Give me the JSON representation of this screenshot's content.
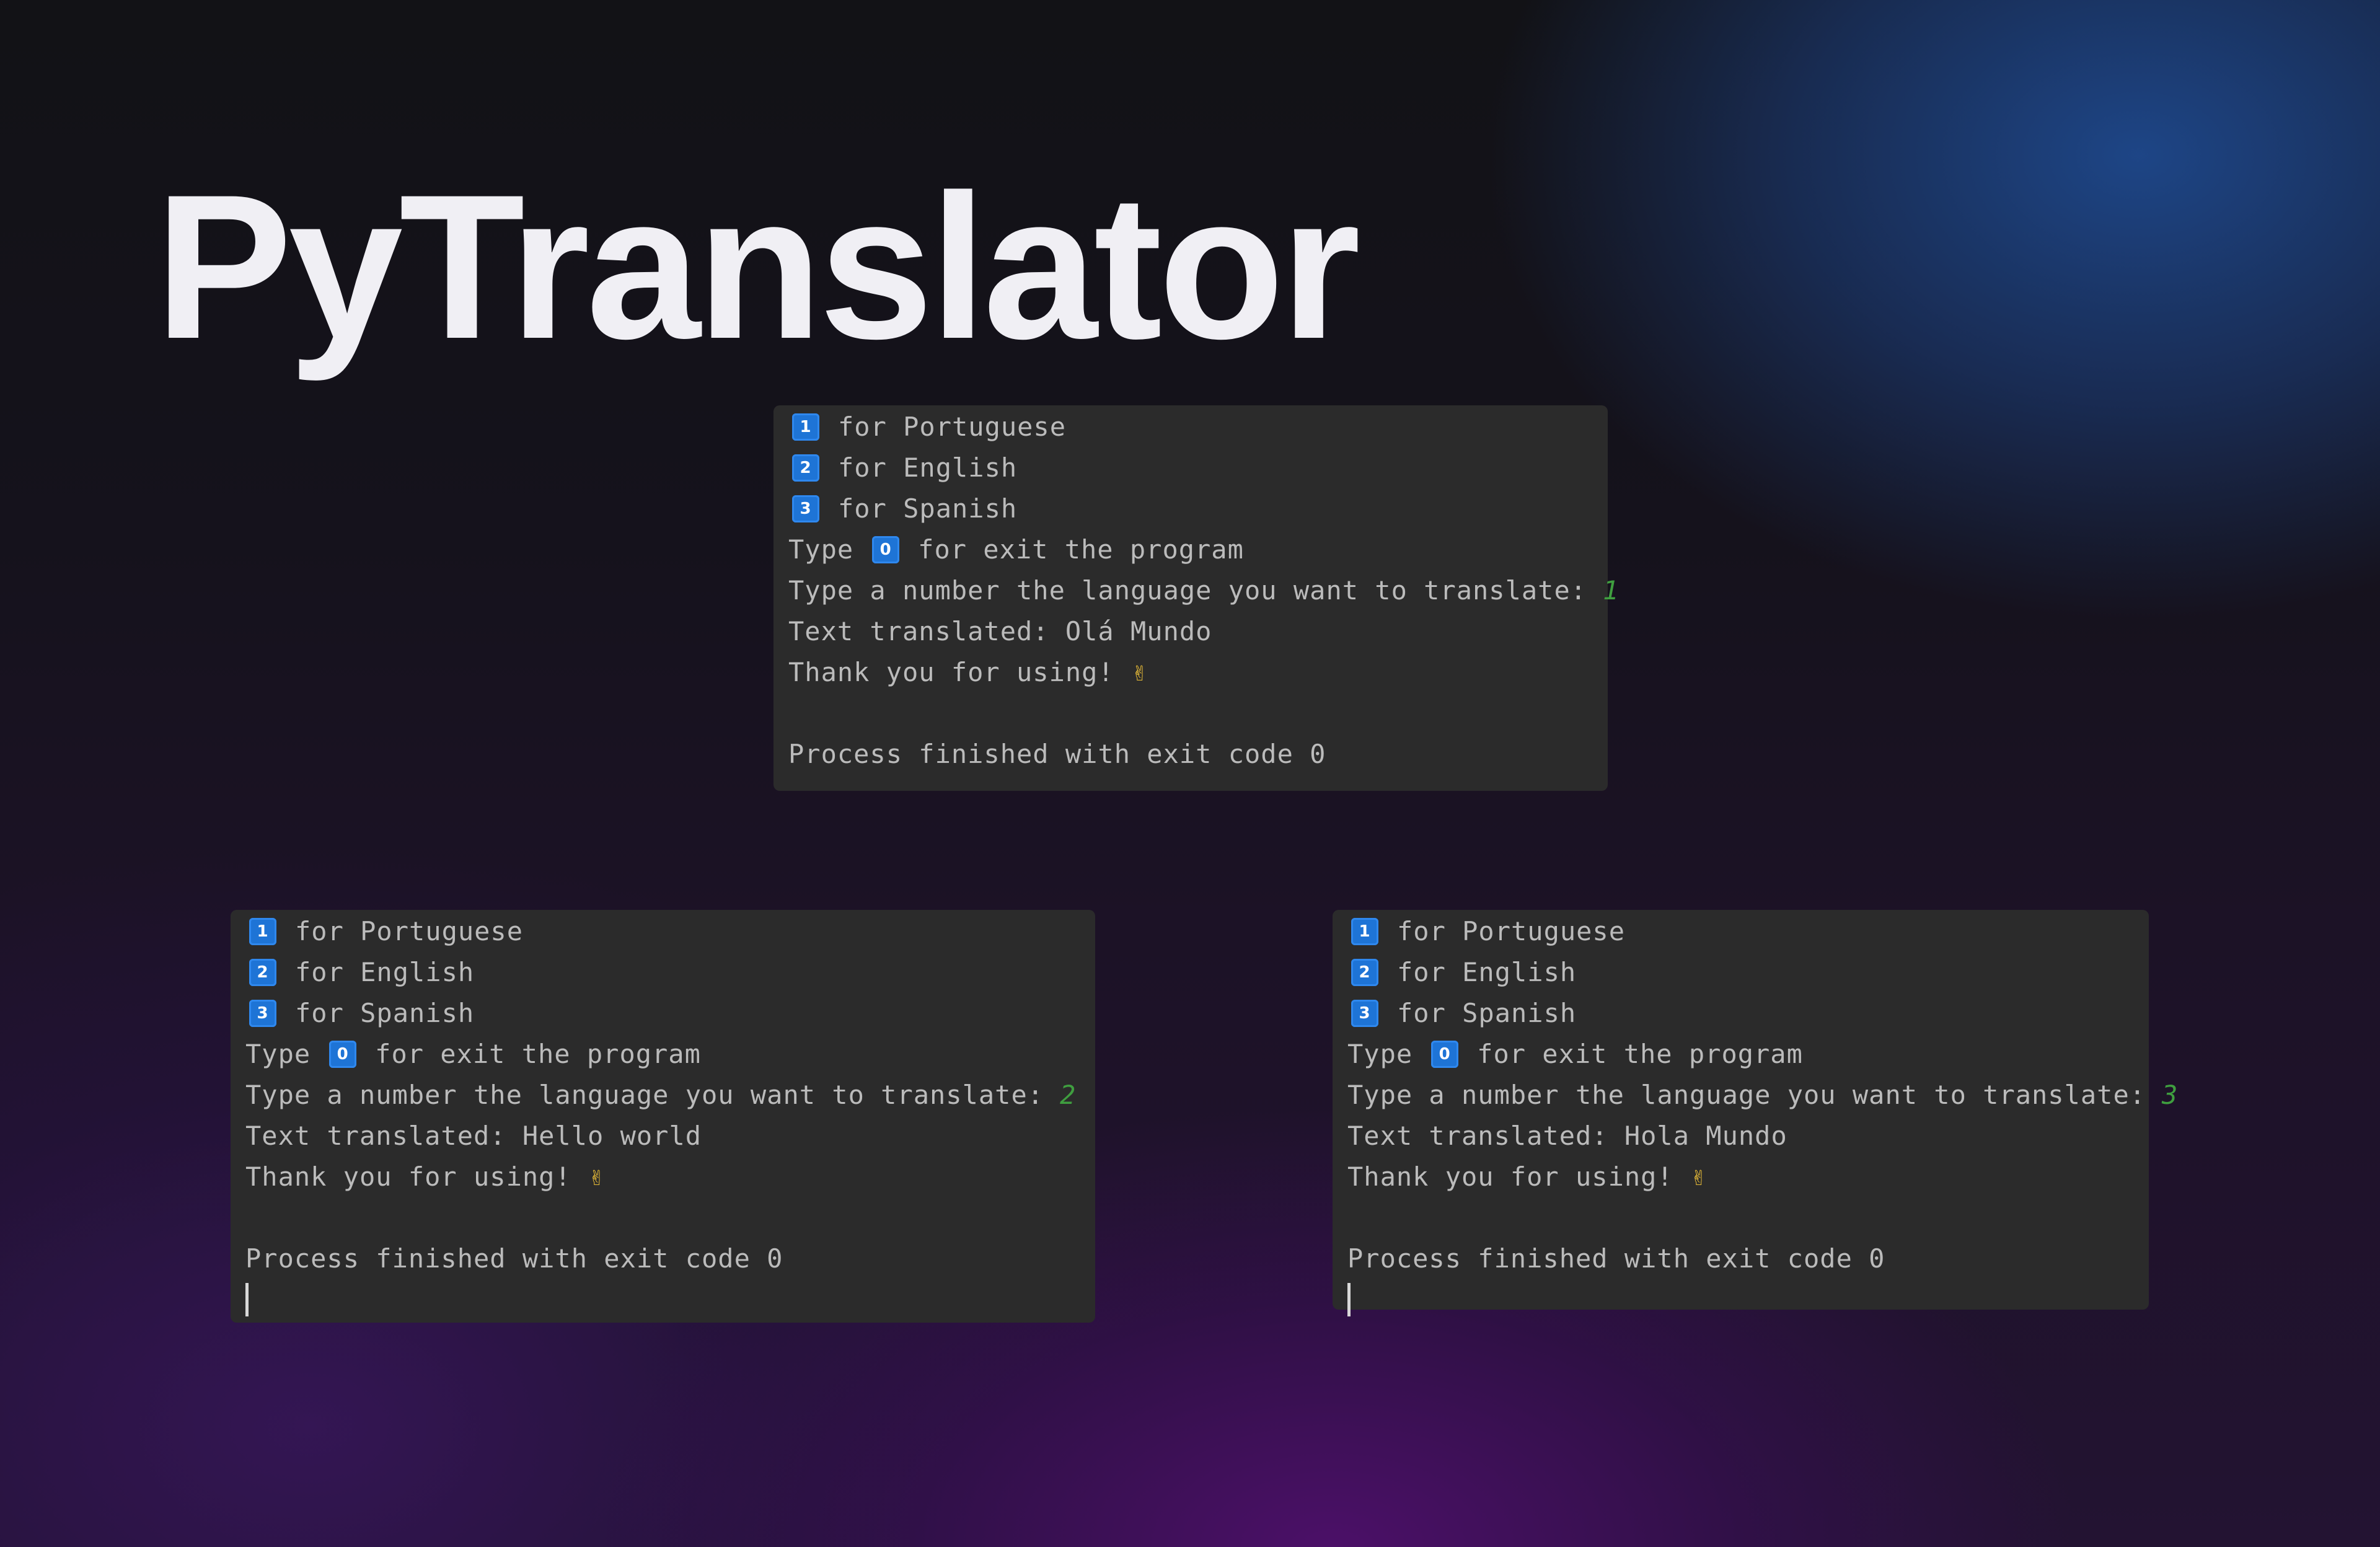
{
  "title": "PyTranslator",
  "colors": {
    "console_bg": "#2b2b2b",
    "console_text": "#bbbbbb",
    "key_badge": "#1e74d6",
    "user_input": "#3f9e3f",
    "title": "#f0eff4"
  },
  "menu": {
    "key_1": "1",
    "key_2": "2",
    "key_3": "3",
    "key_0": "0",
    "option_portuguese": "for Portuguese",
    "option_english": "for English",
    "option_spanish": "for Spanish",
    "exit_prefix": "Type",
    "exit_suffix": "for exit the program",
    "prompt": "Type a number the language you want to translate:",
    "thanks": "Thank you for using!",
    "emoji_icon": "victory-hand-icon",
    "emoji": "✌",
    "process": "Process finished with exit code 0"
  },
  "consoles": {
    "top": {
      "input": "1",
      "translated": "Text translated: Olá Mundo"
    },
    "left": {
      "input": "2",
      "translated": "Text translated: Hello world"
    },
    "right": {
      "input": "3",
      "translated": "Text translated: Hola Mundo"
    }
  }
}
